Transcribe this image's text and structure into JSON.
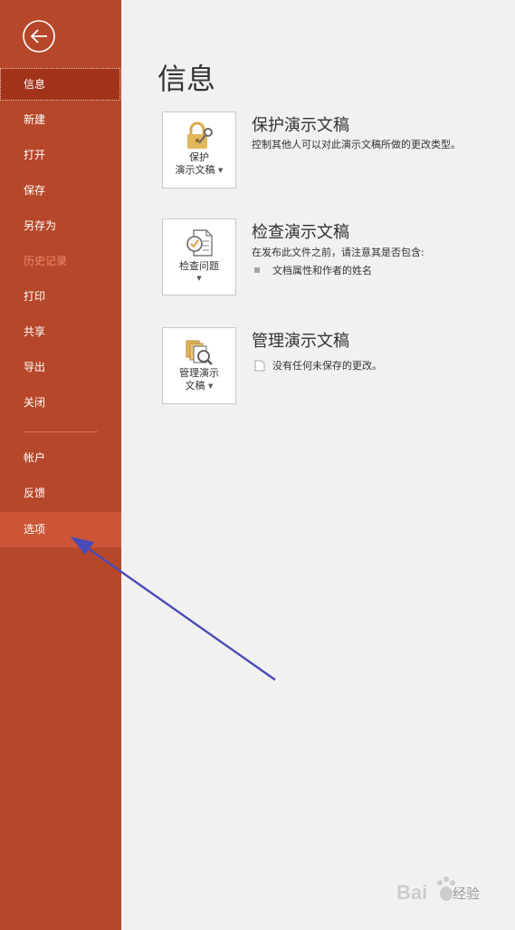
{
  "sidebar": {
    "items": [
      {
        "label": "信息"
      },
      {
        "label": "新建"
      },
      {
        "label": "打开"
      },
      {
        "label": "保存"
      },
      {
        "label": "另存为"
      },
      {
        "label": "历史记录"
      },
      {
        "label": "打印"
      },
      {
        "label": "共享"
      },
      {
        "label": "导出"
      },
      {
        "label": "关闭"
      },
      {
        "label": "帐户"
      },
      {
        "label": "反馈"
      },
      {
        "label": "选项"
      }
    ],
    "selected": "信息",
    "disabled": "历史记录",
    "hovered": "选项"
  },
  "main": {
    "title": "信息",
    "sections": [
      {
        "card_label_line1": "保护",
        "card_label_line2": "演示文稿",
        "title": "保护演示文稿",
        "description": "控制其他人可以对此演示文稿所做的更改类型。"
      },
      {
        "card_label_line1": "检查问题",
        "title": "检查演示文稿",
        "description": "在发布此文件之前，请注意其是否包含:",
        "bullets": [
          "文档属性和作者的姓名"
        ]
      },
      {
        "card_label_line1": "管理演示",
        "card_label_line2": "文稿",
        "title": "管理演示文稿",
        "note": "没有任何未保存的更改。"
      }
    ]
  },
  "icons": {
    "back": "back-arrow-icon",
    "protect": "lock-key-icon",
    "inspect": "inspect-document-icon",
    "manage": "manage-versions-icon"
  },
  "watermark": {
    "text": "经验"
  },
  "colors": {
    "sidebar": "#b7472a",
    "selected": "#a1331a",
    "hover": "#cb5536",
    "disabled_text": "#e88b72",
    "arrow": "#4a4ab8"
  }
}
